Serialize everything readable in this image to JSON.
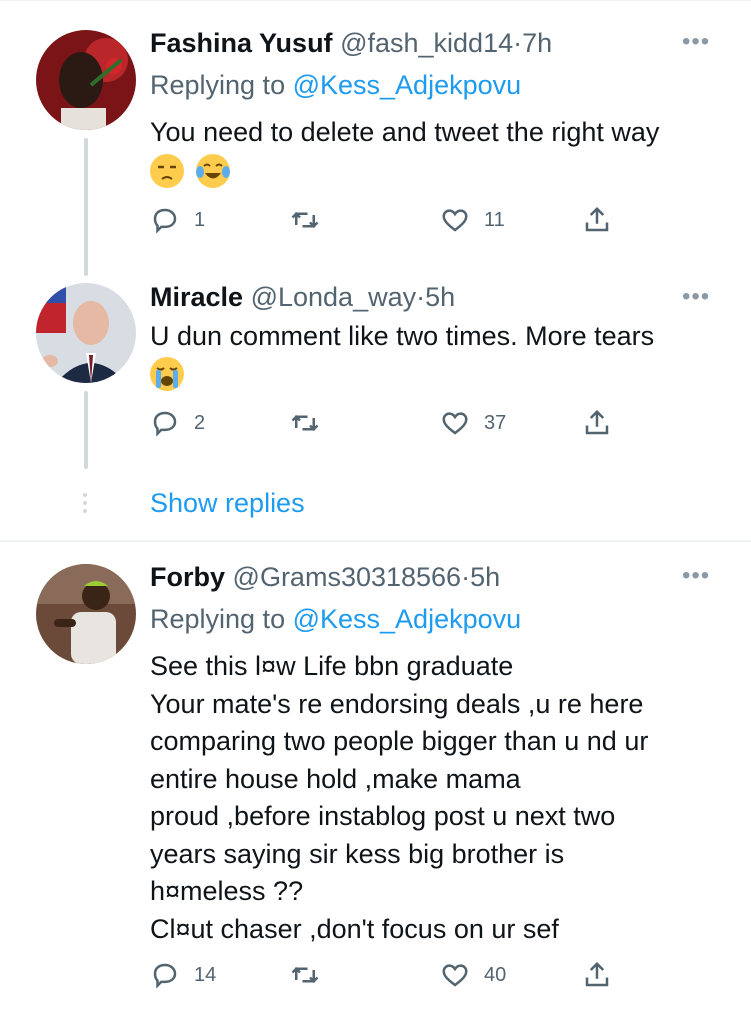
{
  "tweets": [
    {
      "name": "Fashina Yusuf",
      "handle": "@fash_kidd14",
      "dot": "·",
      "time": "7h",
      "replying_prefix": "Replying to ",
      "replying_to": "@Kess_Adjekpovu",
      "body": [
        "You need to delete and tweet the right way"
      ],
      "emojis": [
        "unamused-face",
        "face-with-tears-of-joy"
      ],
      "replies": "1",
      "likes": "11"
    },
    {
      "name": "Miracle",
      "handle": "@Londa_way",
      "dot": "·",
      "time": "5h",
      "body": [
        "U dun comment like two times. More tears"
      ],
      "emojis": [
        "loudly-crying-face"
      ],
      "replies": "2",
      "likes": "37"
    },
    {
      "name": "Forby",
      "handle": "@Grams30318566",
      "dot": "·",
      "time": "5h",
      "replying_prefix": "Replying to ",
      "replying_to": "@Kess_Adjekpovu",
      "body": [
        "See this l¤w Life bbn graduate",
        "Your mate's re endorsing deals ,u re here",
        "comparing two people bigger than u nd ur",
        "entire house hold ,make mama",
        "proud ,before instablog post u next two",
        "years saying sir kess big brother is",
        "h¤meless ??",
        "Cl¤ut chaser ,don't focus on ur sef"
      ],
      "replies": "14",
      "likes": "40"
    }
  ],
  "show_replies": "Show replies",
  "more_label": "•••",
  "icons": {
    "reply": "reply-icon",
    "retweet": "retweet-icon",
    "like": "heart-icon",
    "share": "share-icon"
  },
  "colors": {
    "accent": "#1d9bf0",
    "secondary_text": "#536471",
    "thread_line": "#cfd9de"
  }
}
